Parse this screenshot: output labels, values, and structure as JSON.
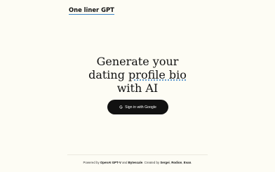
{
  "header": {
    "logo_text": "One liner GPT"
  },
  "hero": {
    "line1": "Generate your",
    "line2_prefix": "dating ",
    "line2_accent": "profile bio",
    "line3": "with AI"
  },
  "signin": {
    "label": "Sign in with Google",
    "icon": "google-icon"
  },
  "footer": {
    "text1": "Powered by ",
    "link1": "OpenAI GPT-V",
    "text2": " and ",
    "link2": "Bytescale",
    "text3": ". Created by ",
    "link3": "Sergei",
    "text4": ", ",
    "link4": "Rodion",
    "text5": ", ",
    "link5": "Evan",
    "text6": "."
  },
  "colors": {
    "background": "#fdfcf4",
    "accent": "#3b82c4",
    "button": "#111111"
  }
}
